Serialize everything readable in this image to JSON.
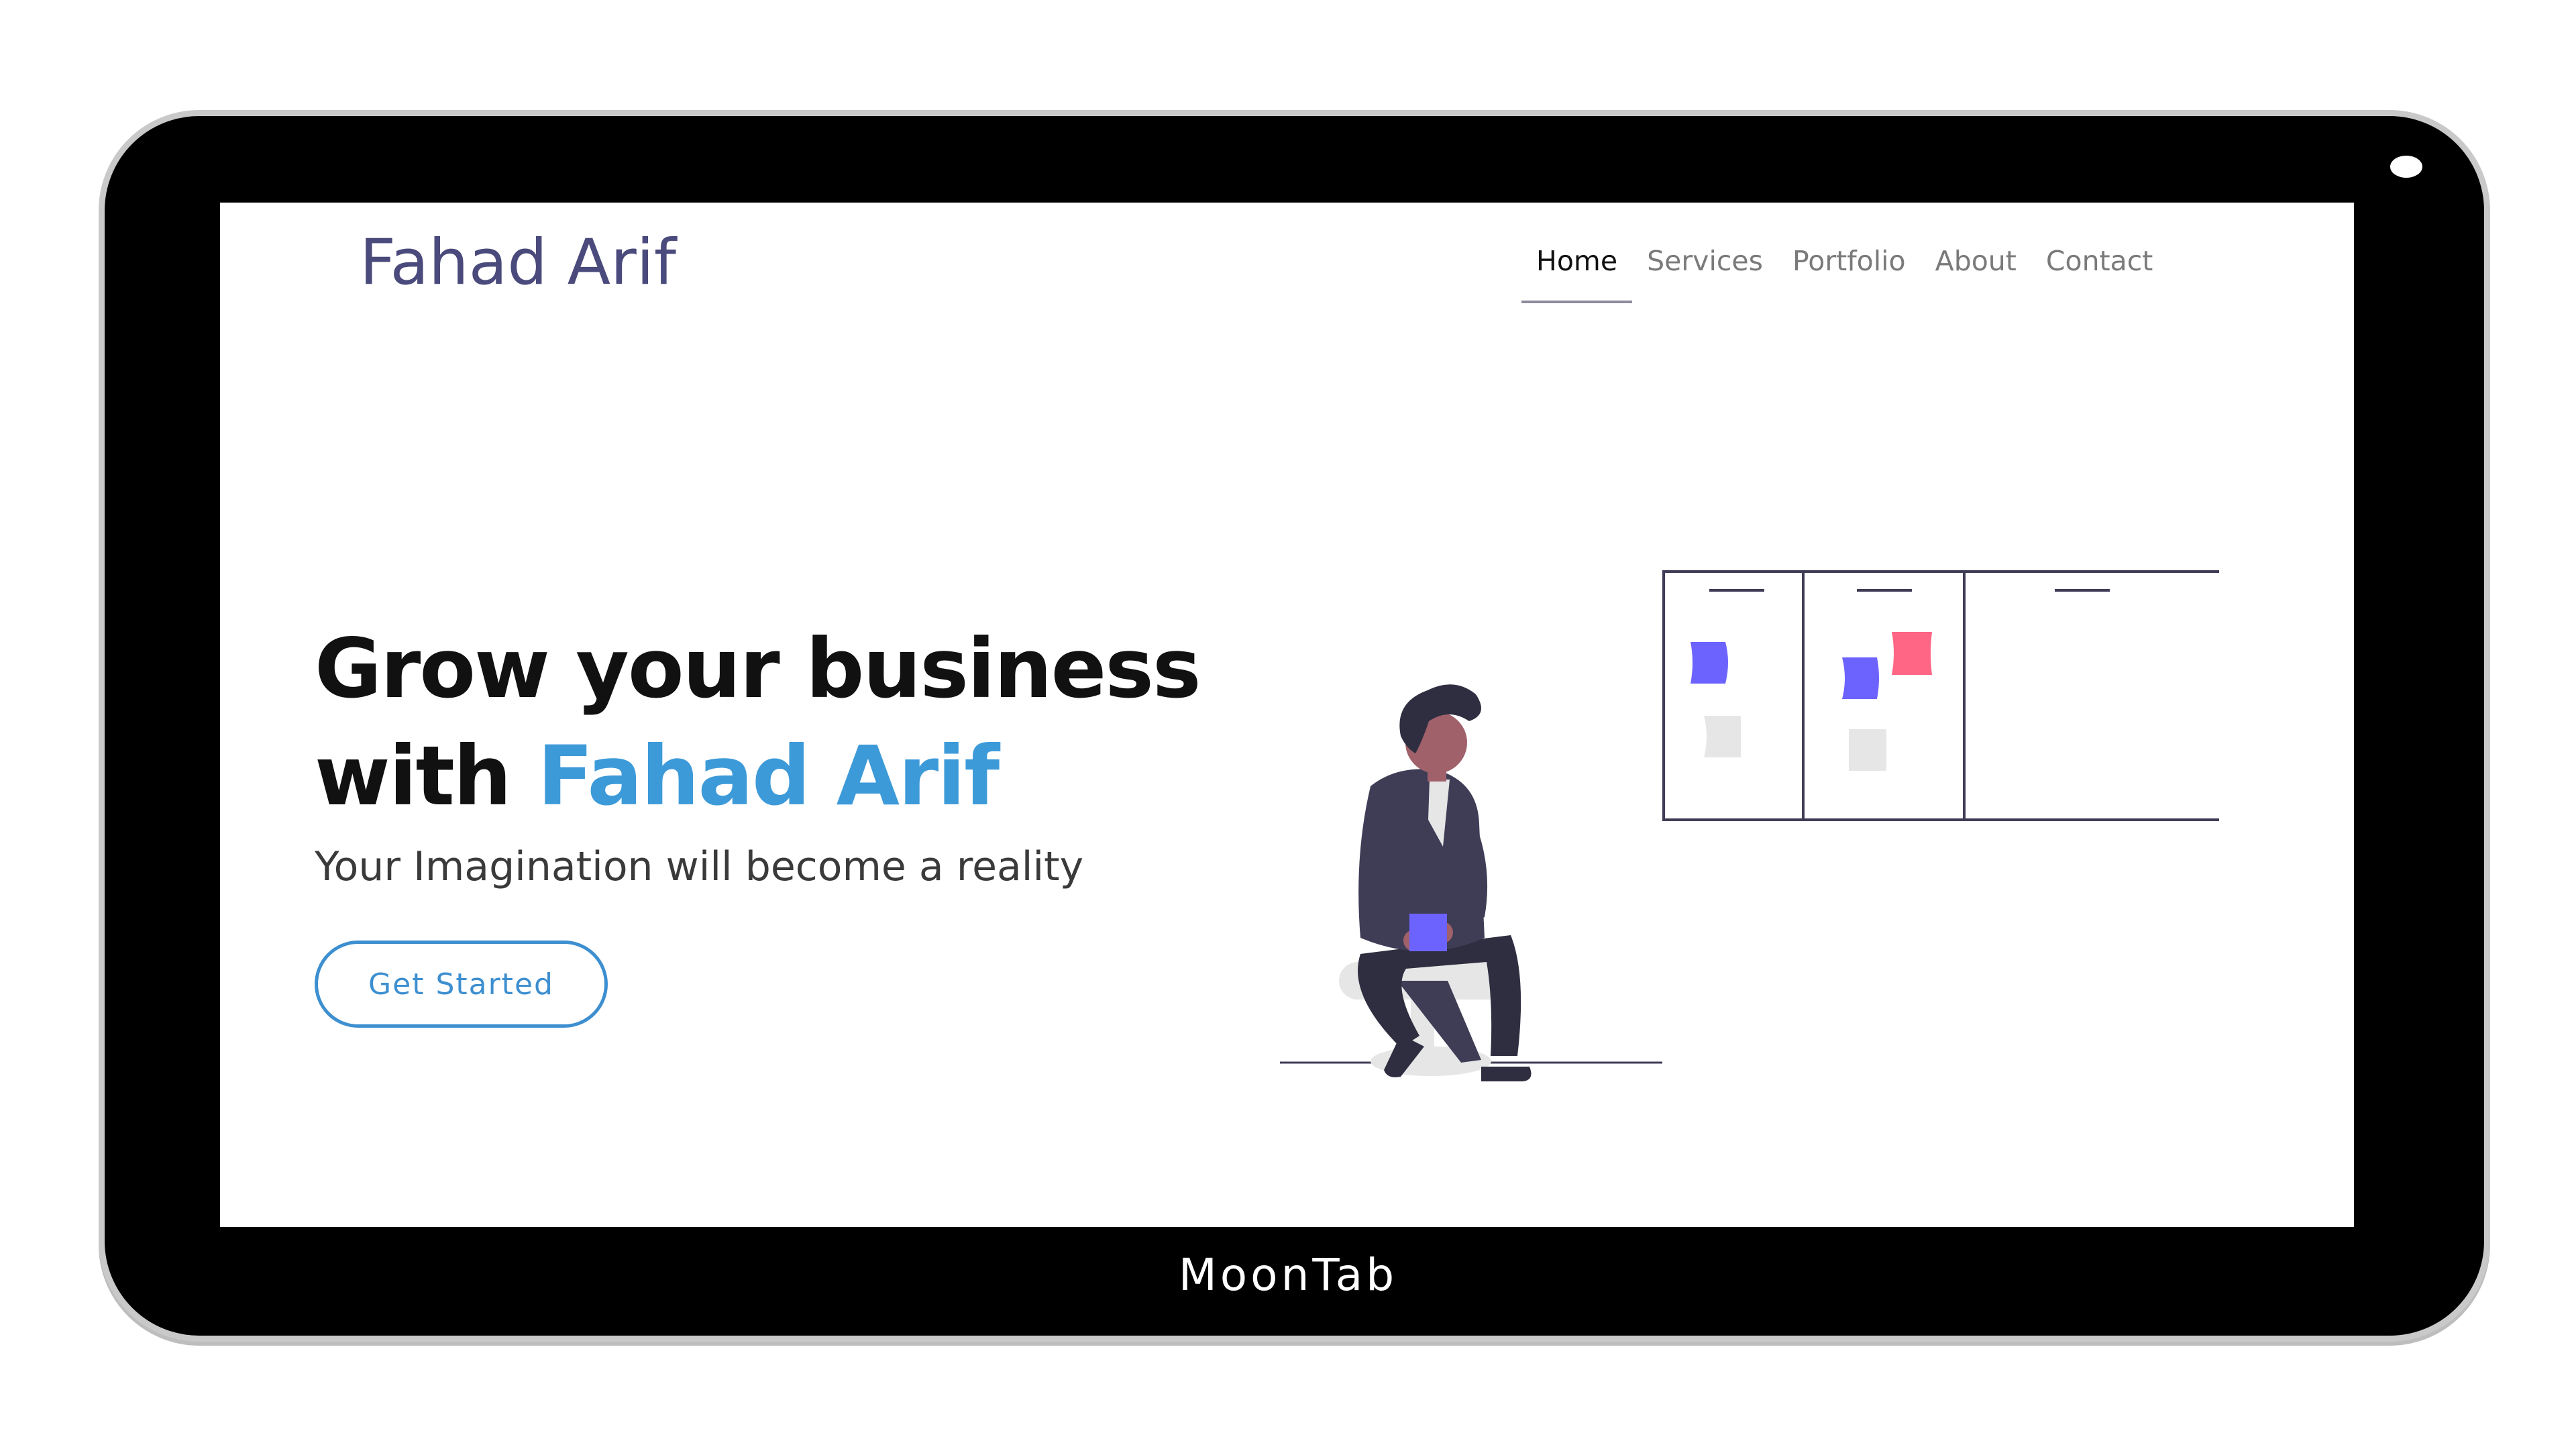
{
  "device": {
    "brand": "MoonTab"
  },
  "site": {
    "logo": "Fahad Arif",
    "nav": [
      {
        "label": "Home",
        "active": true
      },
      {
        "label": "Services",
        "active": false
      },
      {
        "label": "Portfolio",
        "active": false
      },
      {
        "label": "About",
        "active": false
      },
      {
        "label": "Contact",
        "active": false
      }
    ]
  },
  "hero": {
    "title_line1": "Grow your business",
    "title_line2_prefix": "with ",
    "title_line2_accent": "Fahad Arif",
    "subtitle": "Your Imagination will become a reality",
    "cta_label": "Get Started"
  },
  "colors": {
    "accent": "#3d9ad9",
    "logo": "#4a4a7c",
    "note_purple": "#6c63ff",
    "note_pink": "#ff6584",
    "figure_dark": "#3f3d56"
  }
}
